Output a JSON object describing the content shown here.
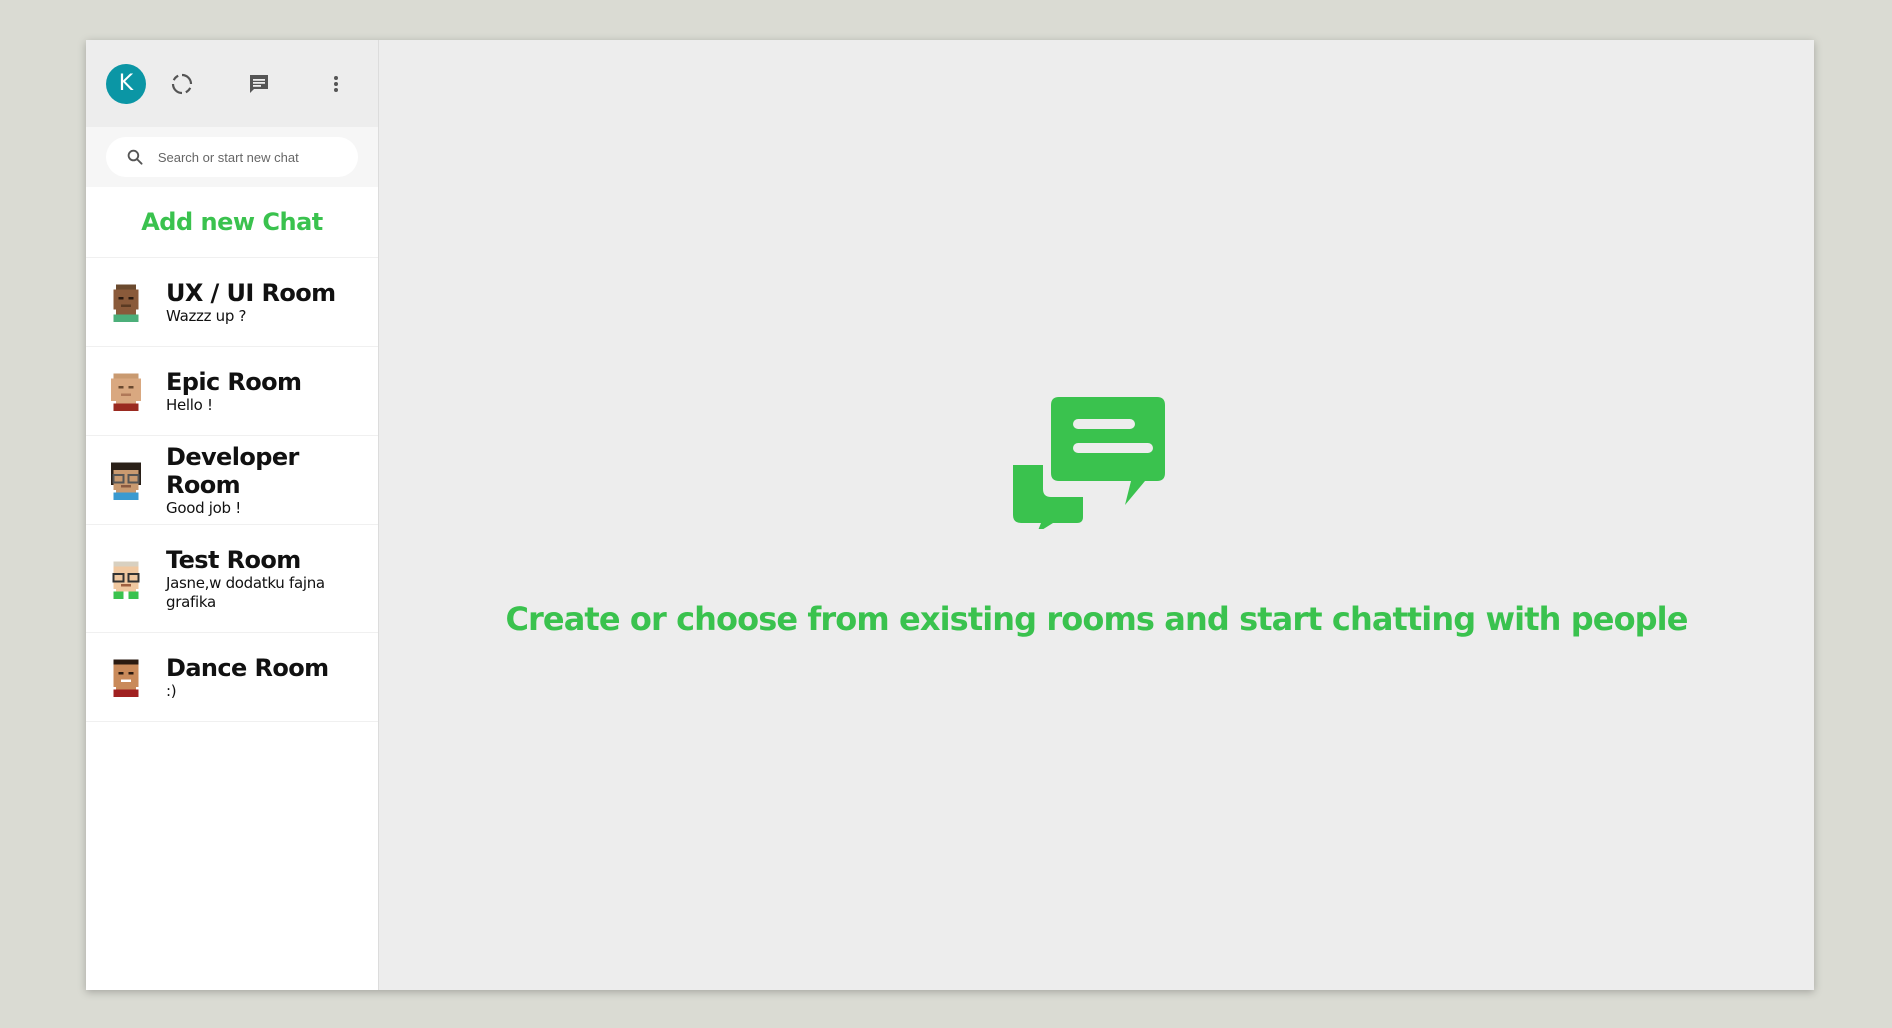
{
  "colors": {
    "accent": "#3ac24e",
    "avatar_bg": "#0b96a5",
    "icon_gray": "#555555"
  },
  "header": {
    "avatar_letter": "K",
    "icons": [
      "status-icon",
      "chat-icon",
      "more-vert-icon"
    ]
  },
  "search": {
    "placeholder": "Search or start new chat"
  },
  "sidebar": {
    "add_chat_label": "Add new Chat",
    "rooms": [
      {
        "name": "UX / UI Room",
        "last_message": "Wazzz up ?",
        "avatar": "pixel-avatar-icon"
      },
      {
        "name": "Epic Room",
        "last_message": "Hello !",
        "avatar": "pixel-avatar-icon"
      },
      {
        "name": "Developer Room",
        "last_message": "Good job !",
        "avatar": "pixel-avatar-icon"
      },
      {
        "name": "Test Room",
        "last_message": "Jasne,w dodatku fajna grafika",
        "avatar": "pixel-avatar-icon"
      },
      {
        "name": "Dance Room",
        "last_message": ":)",
        "avatar": "pixel-avatar-icon"
      }
    ]
  },
  "main": {
    "welcome_text": "Create or choose from existing rooms and start chatting with people",
    "welcome_icon": "chat-bubbles-icon"
  }
}
